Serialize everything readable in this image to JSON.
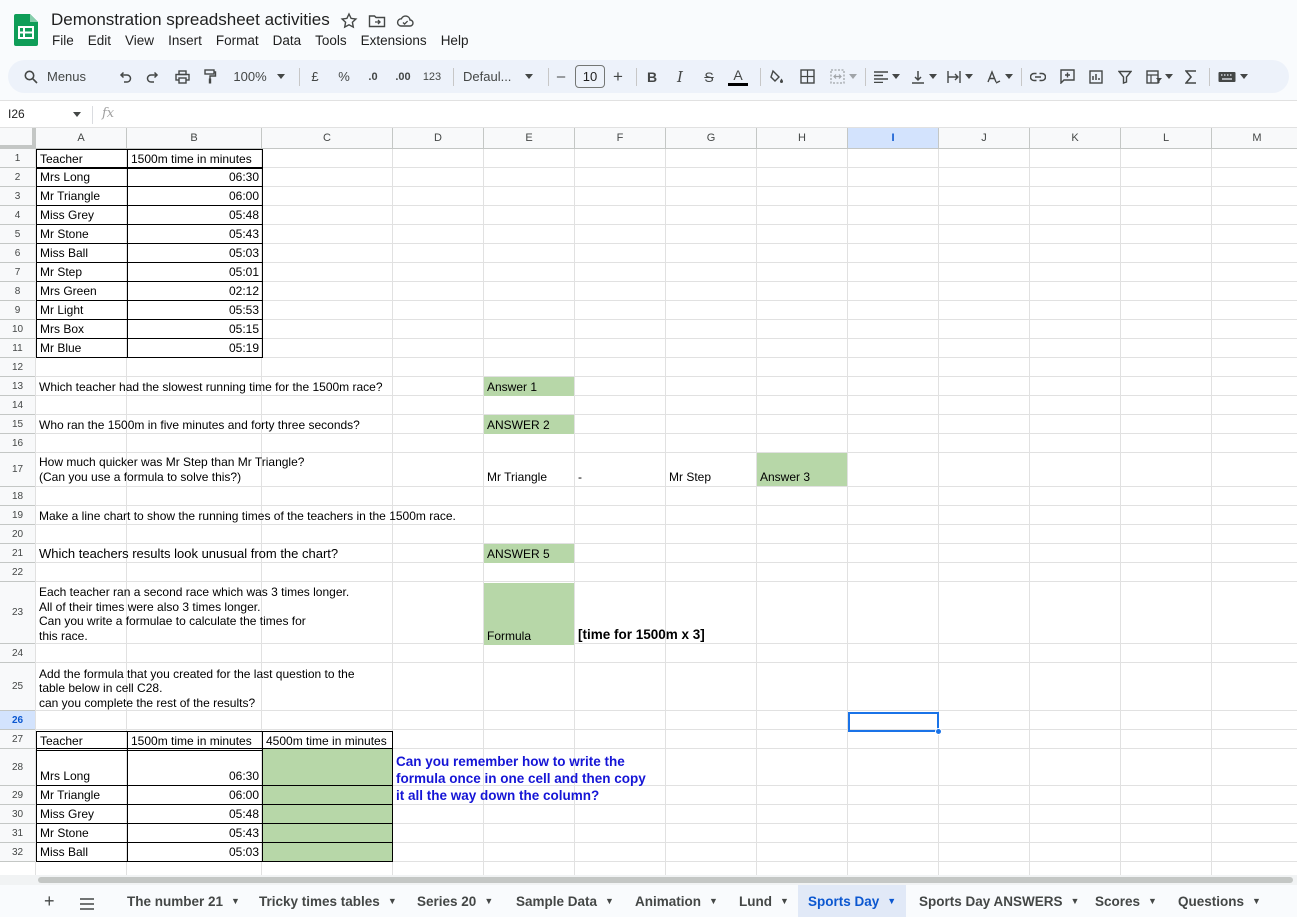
{
  "title": {
    "doc_title": "Demonstration spreadsheet activities",
    "icons": [
      "star-icon",
      "move-to-folder-icon",
      "cloud-status-icon"
    ]
  },
  "menubar": {
    "items": [
      "File",
      "Edit",
      "View",
      "Insert",
      "Format",
      "Data",
      "Tools",
      "Extensions",
      "Help"
    ]
  },
  "toolbar": {
    "menus_label": "Menus",
    "zoom": "100%",
    "currency": "£",
    "percent": "%",
    "decrease_decimal": ".0",
    "increase_decimal": ".00",
    "number_format": "123",
    "font": "Defaul...",
    "font_size": "10",
    "minus": "–",
    "plus": "+",
    "bold": "B",
    "italic": "I",
    "strike": "S",
    "text_color": "A"
  },
  "formula_bar": {
    "name_box": "I26",
    "fx": "fx",
    "formula": ""
  },
  "columns": [
    "A",
    "B",
    "C",
    "D",
    "E",
    "F",
    "G",
    "H",
    "I",
    "J",
    "K",
    "L",
    "M"
  ],
  "selected_column": "I",
  "rows": [
    "1",
    "2",
    "3",
    "4",
    "5",
    "6",
    "7",
    "8",
    "9",
    "10",
    "11",
    "12",
    "13",
    "14",
    "15",
    "16",
    "17",
    "18",
    "19",
    "20",
    "21",
    "22",
    "23",
    "24",
    "25",
    "26",
    "27",
    "28",
    "29",
    "30",
    "31",
    "32"
  ],
  "selected_row": "26",
  "sheet": {
    "table1_header": {
      "teacher": "Teacher",
      "time": "1500m time in minutes"
    },
    "table1": [
      {
        "teacher": "Mrs Long",
        "time": "06:30"
      },
      {
        "teacher": "Mr Triangle",
        "time": "06:00"
      },
      {
        "teacher": "Miss Grey",
        "time": "05:48"
      },
      {
        "teacher": "Mr Stone",
        "time": "05:43"
      },
      {
        "teacher": "Miss Ball",
        "time": "05:03"
      },
      {
        "teacher": "Mr Step",
        "time": "05:01"
      },
      {
        "teacher": "Mrs Green",
        "time": "02:12"
      },
      {
        "teacher": "Mr Light",
        "time": "05:53"
      },
      {
        "teacher": "Mrs Box",
        "time": "05:15"
      },
      {
        "teacher": "Mr Blue",
        "time": "05:19"
      }
    ],
    "q13": "Which teacher had the slowest running time for the 1500m race?",
    "a13": "Answer 1",
    "q15": "Who ran the 1500m in five minutes and forty three seconds?",
    "a15": "ANSWER 2",
    "q17": "How much quicker was Mr Step than Mr Triangle?\n(Can you use a formula to solve this?)",
    "e17": "Mr Triangle",
    "f17": "-",
    "g17": "Mr Step",
    "a17": "Answer 3",
    "q19": "Make a line chart to show the running times of the teachers in the 1500m race.",
    "q21": "Which teachers results look unusual from the chart?",
    "a21": "ANSWER 5",
    "q23": "Each teacher ran a second race which was 3 times longer.\nAll of their times were also 3 times longer.\nCan you write a formulae to calculate the times for\nthis race.",
    "a23": "Formula",
    "hint23": "[time for 1500m x 3]",
    "q25": "Add the formula that you created for the last question to the\ntable below in cell C28.\ncan you complete the rest of the results?",
    "table2_header": {
      "teacher": "Teacher",
      "time": "1500m time in minutes",
      "time3": "4500m time in minutes"
    },
    "table2": [
      {
        "teacher": "Mrs Long",
        "time": "06:30"
      },
      {
        "teacher": "Mr Triangle",
        "time": "06:00"
      },
      {
        "teacher": "Miss Grey",
        "time": "05:48"
      },
      {
        "teacher": "Mr Stone",
        "time": "05:43"
      },
      {
        "teacher": "Miss Ball",
        "time": "05:03"
      }
    ],
    "note28": "Can you remember how to write the\nformula once in one cell and then copy\nit all the way down the column?"
  },
  "sheet_tabs": {
    "tabs": [
      "The number 21",
      "Tricky times tables",
      "Series 20",
      "Sample Data",
      "Animation",
      "Lund",
      "Sports Day",
      "Sports Day ANSWERS",
      "Scores",
      "Questions"
    ],
    "active": "Sports Day"
  },
  "colors": {
    "answer_fill": "#b7d7a8",
    "note_text": "#1515d6",
    "selection": "#1a73e8",
    "active_tab": "#0b57d0"
  }
}
